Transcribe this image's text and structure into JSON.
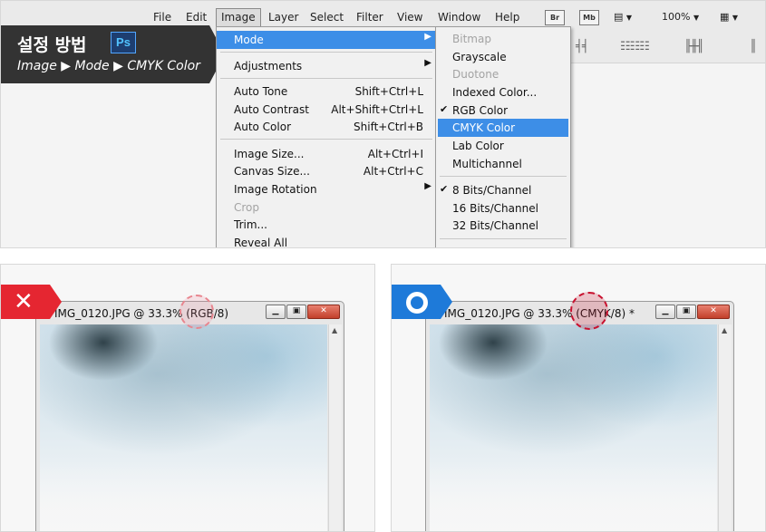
{
  "badge": {
    "title": "설정 방법",
    "app_icon_text": "Ps",
    "path": "Image ▶ Mode ▶ CMYK Color"
  },
  "menubar": {
    "items": [
      "File",
      "Edit",
      "Image",
      "Layer",
      "Select",
      "Filter",
      "View",
      "Window",
      "Help"
    ],
    "active": "Image",
    "bridge_btn": "Br",
    "minibridge_btn": "Mb",
    "zoom": "100%"
  },
  "image_menu": {
    "items": [
      {
        "label": "Mode",
        "shortcut": "",
        "submenu": true,
        "highlighted": true
      },
      {
        "label": "Adjustments",
        "shortcut": "",
        "submenu": true
      },
      {
        "label": "Auto Tone",
        "shortcut": "Shift+Ctrl+L"
      },
      {
        "label": "Auto Contrast",
        "shortcut": "Alt+Shift+Ctrl+L"
      },
      {
        "label": "Auto Color",
        "shortcut": "Shift+Ctrl+B"
      },
      {
        "label": "Image Size...",
        "shortcut": "Alt+Ctrl+I"
      },
      {
        "label": "Canvas Size...",
        "shortcut": "Alt+Ctrl+C"
      },
      {
        "label": "Image Rotation",
        "shortcut": "",
        "submenu": true
      },
      {
        "label": "Crop",
        "shortcut": "",
        "disabled": true
      },
      {
        "label": "Trim...",
        "shortcut": ""
      },
      {
        "label": "Reveal All",
        "shortcut": ""
      }
    ]
  },
  "mode_submenu": {
    "items": [
      {
        "label": "Bitmap",
        "disabled": true
      },
      {
        "label": "Grayscale"
      },
      {
        "label": "Duotone",
        "disabled": true
      },
      {
        "label": "Indexed Color..."
      },
      {
        "label": "RGB Color",
        "checked": true
      },
      {
        "label": "CMYK Color",
        "highlighted": true
      },
      {
        "label": "Lab Color"
      },
      {
        "label": "Multichannel"
      },
      {
        "label": "8 Bits/Channel",
        "checked": true
      },
      {
        "label": "16 Bits/Channel"
      },
      {
        "label": "32 Bits/Channel"
      }
    ],
    "check_glyph": "✔"
  },
  "examples": {
    "wrong": {
      "mark": "✕",
      "title_prefix": "IMG_0120.JPG @ 33.3% ",
      "mode": "(RGB/8)",
      "suffix": ""
    },
    "right": {
      "title_prefix": "IMG_0120.JPG @ 33.3% ",
      "mode": "(CMYK/8)",
      "suffix": " *"
    },
    "window_buttons": {
      "minimize": "▁",
      "maximize": "▣",
      "close": "✕"
    },
    "scroll_up": "▲"
  },
  "colors": {
    "highlight": "#3d8ee7",
    "wrong_mark": "#e52631",
    "right_mark": "#1e7ad9",
    "badge": "#333333"
  }
}
